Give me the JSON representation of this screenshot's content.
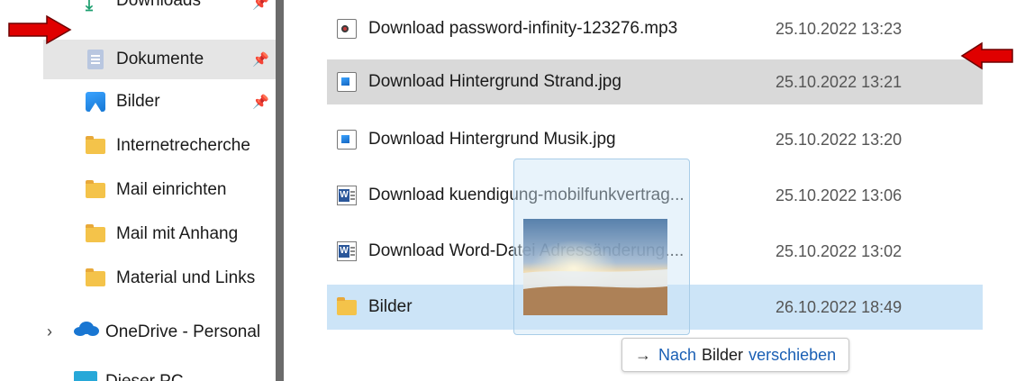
{
  "nav": {
    "items": [
      {
        "label": "Downloads",
        "icon": "download-icon",
        "pinned": true
      },
      {
        "label": "Dokumente",
        "icon": "documents-icon",
        "pinned": true,
        "selected": true
      },
      {
        "label": "Bilder",
        "icon": "pictures-icon",
        "pinned": true
      },
      {
        "label": "Internetrecherche",
        "icon": "folder-icon"
      },
      {
        "label": "Mail einrichten",
        "icon": "folder-icon"
      },
      {
        "label": "Mail mit Anhang",
        "icon": "folder-icon"
      },
      {
        "label": "Material und Links",
        "icon": "folder-icon"
      }
    ],
    "onedrive": {
      "label": "OneDrive - Personal",
      "icon": "cloud-icon"
    },
    "pc": {
      "label": "Dieser PC",
      "icon": "computer-icon"
    },
    "pin_glyph": "📌",
    "chevron": "›"
  },
  "files": [
    {
      "name": "Download password-infinity-123276.mp3",
      "date": "25.10.2022 13:23",
      "icon": "audio-file-icon"
    },
    {
      "name": "Download Hintergrund Strand.jpg",
      "date": "25.10.2022 13:21",
      "icon": "image-file-icon",
      "state": "hover"
    },
    {
      "name": "Download Hintergrund Musik.jpg",
      "date": "25.10.2022 13:20",
      "icon": "image-file-icon"
    },
    {
      "name": "Download kuendigung-mobilfunkvertrag...",
      "date": "25.10.2022 13:06",
      "icon": "word-file-icon"
    },
    {
      "name": "Download Word-Datei Adressänderung....",
      "date": "25.10.2022 13:02",
      "icon": "word-file-icon"
    },
    {
      "name": "Bilder",
      "date": "26.10.2022 18:49",
      "icon": "folder-icon",
      "state": "drop-target"
    }
  ],
  "drop_tooltip": {
    "arrow": "→",
    "action": "Nach",
    "target": "Bilder",
    "verb": "verschieben"
  },
  "colors": {
    "annotation_arrow": "#e00000",
    "drop_highlight": "#cce4f7",
    "hover_row": "#d9d9d9",
    "selected_nav": "#e5e5e5",
    "link_blue": "#1a5fb4"
  }
}
